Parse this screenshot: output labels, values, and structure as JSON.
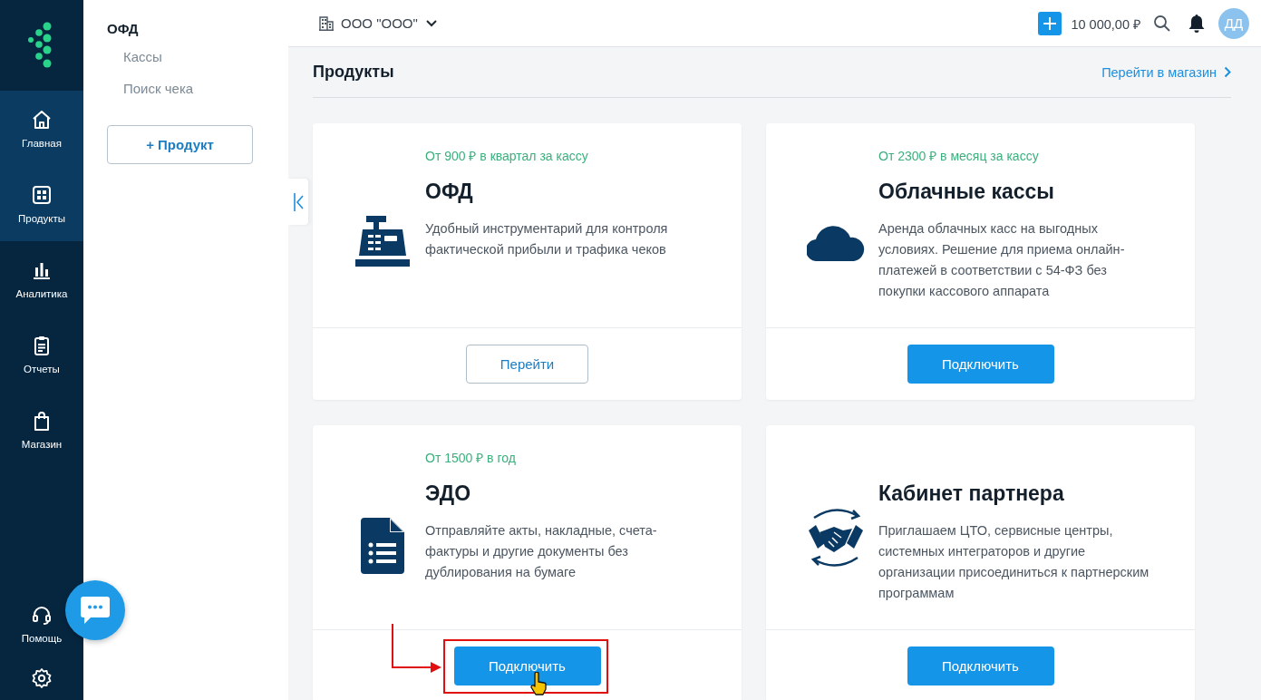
{
  "nav": {
    "items": [
      {
        "label": "Главная",
        "selected": true
      },
      {
        "label": "Продукты",
        "selected": true
      },
      {
        "label": "Аналитика",
        "selected": false
      },
      {
        "label": "Отчеты",
        "selected": false
      },
      {
        "label": "Магазин",
        "selected": false
      }
    ],
    "help": {
      "label": "Помощь"
    }
  },
  "subnav": {
    "title": "ОФД",
    "links": [
      "Кассы",
      "Поиск чека"
    ],
    "add_button": "+ Продукт"
  },
  "topbar": {
    "company": "ООО \"ООО\"",
    "balance": "10 000,00 ₽",
    "avatar": "ДД"
  },
  "page": {
    "title": "Продукты",
    "store_link": "Перейти в магазин"
  },
  "cards": [
    {
      "price": "От 900 ₽ в квартал за кассу",
      "title": "ОФД",
      "description": "Удобный инструментарий для контроля фактической прибыли и трафика чеков",
      "button": {
        "label": "Перейти",
        "kind": "outline"
      }
    },
    {
      "price": "От 2300 ₽ в месяц за кассу",
      "title": "Облачные кассы",
      "description": "Аренда облачных касс на выгодных условиях. Решение для приема онлайн-платежей в соответствии с 54-ФЗ без покупки кассового аппарата",
      "button": {
        "label": "Подключить",
        "kind": "primary"
      }
    },
    {
      "price": "От 1500 ₽ в год",
      "title": "ЭДО",
      "description": "Отправляйте акты, накладные, счета-фактуры и другие документы без дублирования на бумаге",
      "button": {
        "label": "Подключить",
        "kind": "primary"
      }
    },
    {
      "title": "Кабинет партнера",
      "description": "Приглашаем ЦТО, сервисные центры, системных интеграторов и другие организации присоединиться к партнерским программам",
      "button": {
        "label": "Подключить",
        "kind": "primary"
      }
    }
  ]
}
